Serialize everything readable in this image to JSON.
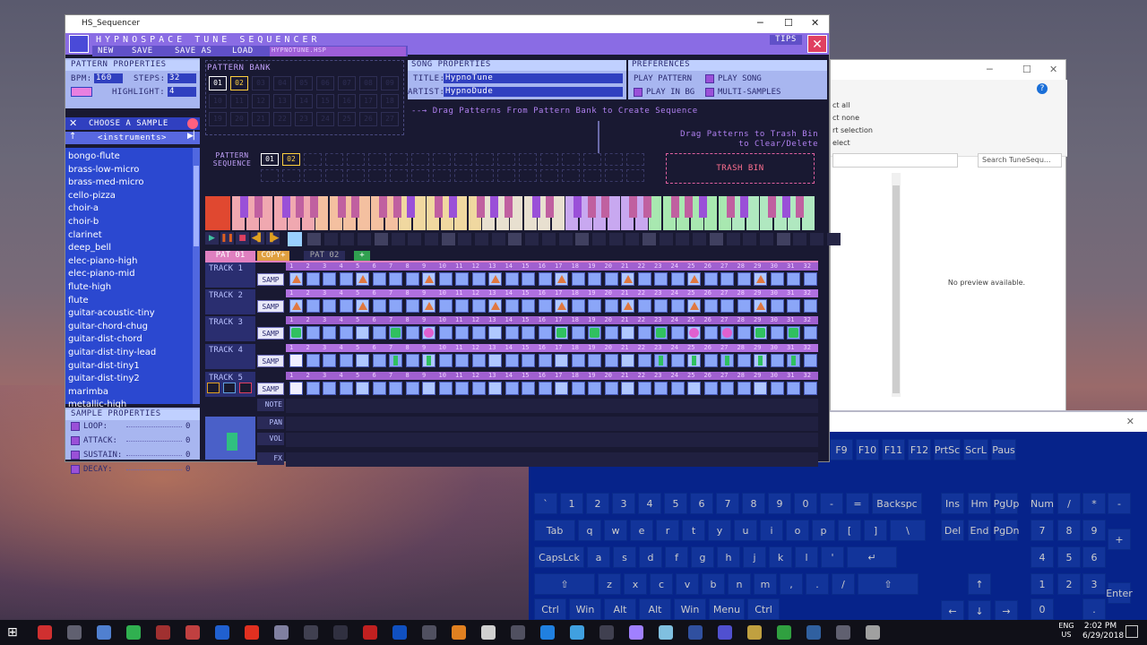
{
  "app": {
    "window_title": "HS_Sequencer",
    "banner": "HYPNOSPACE TUNE SEQUENCER",
    "tips_label": "TIPS",
    "menu": [
      "NEW",
      "SAVE",
      "SAVE AS",
      "LOAD"
    ],
    "file_name": "HYPNOTUNE.HSP"
  },
  "pattern_props": {
    "header": "PATTERN PROPERTIES",
    "bpm_label": "BPM:",
    "bpm": "160",
    "steps_label": "STEPS:",
    "steps": "32",
    "highlight_label": "HIGHLIGHT:",
    "highlight": "4"
  },
  "pattern_bank": {
    "header": "PATTERN BANK",
    "slots": [
      "01",
      "02",
      "03",
      "04",
      "05",
      "06",
      "07",
      "08",
      "09",
      "10",
      "11",
      "12",
      "13",
      "14",
      "15",
      "16",
      "17",
      "18",
      "19",
      "20",
      "21",
      "22",
      "23",
      "24",
      "25",
      "26",
      "27"
    ]
  },
  "song_props": {
    "header": "SONG PROPERTIES",
    "title_label": "TITLE:",
    "title": "HypnoTune",
    "artist_label": "ARTIST:",
    "artist": "HypnoDude"
  },
  "preferences": {
    "header": "PREFERENCES",
    "options": [
      {
        "label": "PLAY PATTERN",
        "checked": false
      },
      {
        "label": "PLAY SONG",
        "checked": true
      },
      {
        "label": "PLAY IN BG",
        "checked": true
      },
      {
        "label": "MULTI-SAMPLES",
        "checked": true
      }
    ]
  },
  "sequence": {
    "hint_drag": "Drag Patterns From Pattern Bank to Create Sequence",
    "hint_trash": "Drag Patterns to Trash Bin to Clear/Delete",
    "label": "PATTERN SEQUENCE",
    "items": [
      "01",
      "02"
    ],
    "trash_label": "TRASH BIN"
  },
  "sampler": {
    "header": "CHOOSE A SAMPLE",
    "category": "<instruments>",
    "samples": [
      "bongo-flute",
      "brass-low-micro",
      "brass-med-micro",
      "cello-pizza",
      "choir-a",
      "choir-b",
      "clarinet",
      "deep_bell",
      "elec-piano-high",
      "elec-piano-mid",
      "flute-high",
      "flute",
      "guitar-acoustic-tiny",
      "guitar-chord-chug",
      "guitar-dist-chord",
      "guitar-dist-tiny-lead",
      "guitar-dist-tiny1",
      "guitar-dist-tiny2",
      "marimba",
      "metallic-high"
    ]
  },
  "sample_props": {
    "header": "SAMPLE PROPERTIES",
    "rows": [
      {
        "label": "LOOP:",
        "value": "0"
      },
      {
        "label": "ATTACK:",
        "value": "0"
      },
      {
        "label": "SUSTAIN:",
        "value": "0"
      },
      {
        "label": "DECAY:",
        "value": "0"
      }
    ]
  },
  "tabs": [
    {
      "label": "PAT 01",
      "active": true
    },
    {
      "label": "COPY+",
      "active": false
    },
    {
      "label": "PAT 02",
      "active": false
    },
    {
      "label": "+",
      "active": false
    }
  ],
  "tracks": [
    {
      "label": "TRACK 1",
      "type": "SAMP"
    },
    {
      "label": "TRACK 2",
      "type": "SAMP"
    },
    {
      "label": "TRACK 3",
      "type": "SAMP"
    },
    {
      "label": "TRACK 4",
      "type": "SAMP"
    },
    {
      "label": "TRACK 5",
      "type": "SAMP"
    }
  ],
  "track5_rows": [
    "NOTE",
    "PAN",
    "VOL",
    "FX"
  ],
  "step_numbers": [
    "1",
    "2",
    "3",
    "4",
    "5",
    "6",
    "7",
    "8",
    "9",
    "10",
    "11",
    "12",
    "13",
    "14",
    "15",
    "16",
    "17",
    "18",
    "19",
    "20",
    "21",
    "22",
    "23",
    "24",
    "25",
    "26",
    "27",
    "28",
    "29",
    "30",
    "31",
    "32"
  ],
  "explorer": {
    "ribbon": [
      "ct all",
      "ct none",
      "rt selection",
      "elect"
    ],
    "search_placeholder": "Search TuneSequ...",
    "preview": "No preview available."
  },
  "osk": {
    "fkeys": [
      "F9",
      "F10",
      "F11",
      "F12",
      "PrtSc",
      "ScrL",
      "Paus"
    ],
    "row1": [
      "`",
      "1",
      "2",
      "3",
      "4",
      "5",
      "6",
      "7",
      "8",
      "9",
      "0",
      "-",
      "=",
      "Backspc"
    ],
    "row2": [
      "Tab",
      "q",
      "w",
      "e",
      "r",
      "t",
      "y",
      "u",
      "i",
      "o",
      "p",
      "[",
      "]",
      "\\"
    ],
    "row3": [
      "CapsLck",
      "a",
      "s",
      "d",
      "f",
      "g",
      "h",
      "j",
      "k",
      "l",
      "'",
      "↵"
    ],
    "row4": [
      "⇧",
      "z",
      "x",
      "c",
      "v",
      "b",
      "n",
      "m",
      ",",
      ".",
      "/",
      "⇧"
    ],
    "row5": [
      "Ctrl",
      "Win",
      "Alt",
      "Alt",
      "Win",
      "Menu",
      "Ctrl"
    ],
    "nav": [
      "Ins",
      "Hm",
      "PgUp",
      "Del",
      "End",
      "PgDn",
      "↑",
      "←",
      "↓",
      "→"
    ],
    "numpad": [
      "Num",
      "/",
      "*",
      "-",
      "7",
      "8",
      "9",
      "+",
      "4",
      "5",
      "6",
      "1",
      "2",
      "3",
      "Enter",
      "0",
      "."
    ]
  },
  "taskbar": {
    "time": "2:02 PM",
    "date": "6/29/2018",
    "lang": "ENG",
    "region": "US"
  },
  "colors": {
    "accent": "#8a6ce4",
    "panel": "#191932",
    "step": "#8ba6f8",
    "highlight": "#e4a0f0"
  }
}
